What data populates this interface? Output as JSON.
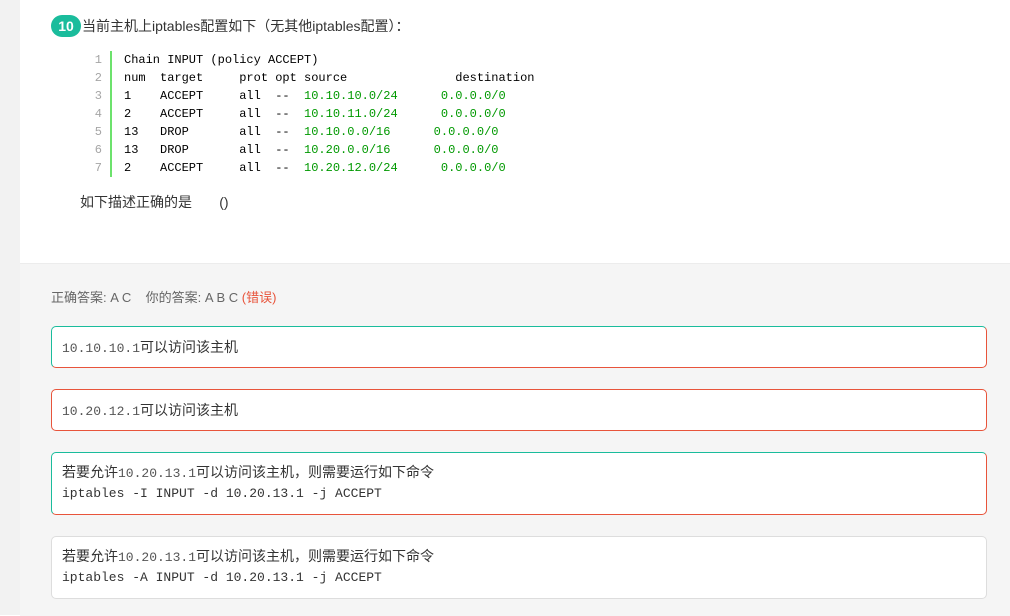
{
  "question": {
    "number": "10",
    "text": "当前主机上iptables配置如下（无其他iptables配置）：",
    "code_lines": [
      {
        "num": "1",
        "pre": "Chain INPUT (policy ACCEPT)",
        "src": "",
        "post": ""
      },
      {
        "num": "2",
        "pre": "num  target     prot opt source               destination",
        "src": "",
        "post": ""
      },
      {
        "num": "3",
        "pre": "1    ACCEPT     all  --  ",
        "src": "10.10.10.0/24",
        "post": "      0.0.0.0/0"
      },
      {
        "num": "4",
        "pre": "2    ACCEPT     all  --  ",
        "src": "10.10.11.0/24",
        "post": "      0.0.0.0/0"
      },
      {
        "num": "5",
        "pre": "13   DROP       all  --  ",
        "src": "10.10.0.0/16",
        "post": "      0.0.0.0/0"
      },
      {
        "num": "6",
        "pre": "13   DROP       all  --  ",
        "src": "10.20.0.0/16",
        "post": "      0.0.0.0/0"
      },
      {
        "num": "7",
        "pre": "2    ACCEPT     all  --  ",
        "src": "10.20.12.0/24",
        "post": "      0.0.0.0/0"
      }
    ],
    "suffix": "如下描述正确的是       ()"
  },
  "answer": {
    "correct_label": "正确答案:",
    "correct_value": "A C",
    "yours_label": "你的答案:",
    "yours_value": "A B C",
    "status": "(错误)"
  },
  "options": [
    {
      "mono": "10.10.10.1",
      "text": "可以访问该主机",
      "cmd": ""
    },
    {
      "mono": "10.20.12.1",
      "text": "可以访问该主机",
      "cmd": ""
    },
    {
      "prefix": "若要允许",
      "mono": "10.20.13.1",
      "text": "可以访问该主机，则需要运行如下命令",
      "cmd": "iptables -I INPUT -d 10.20.13.1 -j ACCEPT"
    },
    {
      "prefix": "若要允许",
      "mono": "10.20.13.1",
      "text": "可以访问该主机，则需要运行如下命令",
      "cmd": "iptables -A INPUT -d 10.20.13.1 -j ACCEPT"
    }
  ],
  "colors": {
    "accent": "#1abc9c",
    "error": "#e8543b",
    "code_ip": "#009900"
  }
}
